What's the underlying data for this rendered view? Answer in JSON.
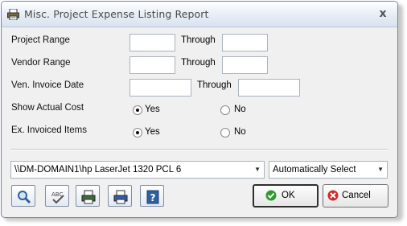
{
  "window": {
    "title": "Misc. Project Expense Listing Report",
    "close_glyph": "x"
  },
  "form": {
    "project_range": {
      "label": "Project Range",
      "through": "Through",
      "from": "",
      "to": ""
    },
    "vendor_range": {
      "label": "Vendor Range",
      "through": "Through",
      "from": "",
      "to": ""
    },
    "invoice_date": {
      "label": "Ven. Invoice Date",
      "through": "Through",
      "from": "",
      "to": ""
    },
    "show_actual_cost": {
      "label": "Show Actual Cost",
      "yes": "Yes",
      "no": "No",
      "selected": "Yes"
    },
    "ex_invoiced_items": {
      "label": "Ex. Invoiced Items",
      "yes": "Yes",
      "no": "No",
      "selected": "Yes"
    }
  },
  "printer": {
    "value": "\\\\DM-DOMAIN1\\hp LaserJet 1320 PCL 6"
  },
  "tray": {
    "value": "Automatically Select"
  },
  "buttons": {
    "ok": "OK",
    "cancel": "Cancel"
  },
  "icons": [
    "printer-icon",
    "preview-icon",
    "spellcheck-icon",
    "print-icon",
    "print-setup-icon",
    "help-icon",
    "ok-check-icon",
    "cancel-x-icon"
  ],
  "colors": {
    "ok_green": "#2e9a2e",
    "cancel_red": "#d02b2b",
    "tool_blue": "#2f5f9e"
  }
}
